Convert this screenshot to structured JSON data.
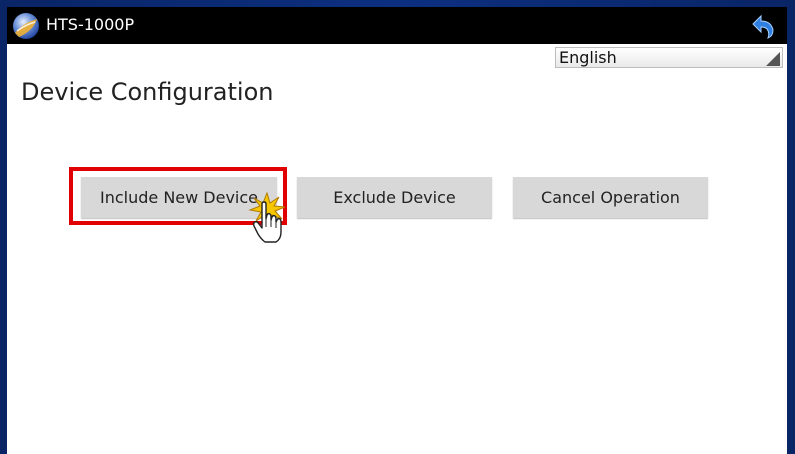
{
  "app": {
    "title": "HTS-1000P"
  },
  "language_select": {
    "value": "English"
  },
  "page": {
    "title": "Device Configuration"
  },
  "buttons": {
    "include_label": "Include New Device",
    "exclude_label": "Exclude Device",
    "cancel_label": "Cancel Operation"
  },
  "icons": {
    "app_logo": "globe-logo-icon",
    "back": "back-arrow-icon",
    "dropdown": "dropdown-corner-icon",
    "cursor": "hand-pointer-icon",
    "click": "click-burst-icon"
  },
  "colors": {
    "frame": "#0b2a72",
    "titlebar": "#000000",
    "button": "#d8d8d8",
    "highlight": "#e00000",
    "back_icon": "#2f7fe0"
  }
}
